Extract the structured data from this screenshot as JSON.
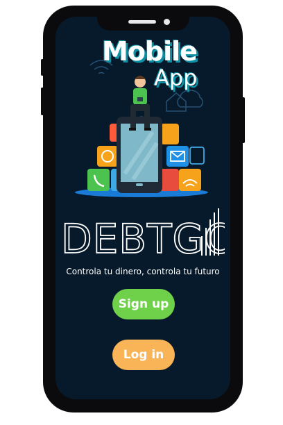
{
  "hero": {
    "title_line1": "Mobile",
    "title_line2": "App"
  },
  "brand": {
    "logo_text": "DEBTGO"
  },
  "tagline": "Controla tu dinero, controla tu futuro",
  "actions": {
    "signup_label": "Sign up",
    "login_label": "Log in"
  },
  "colors": {
    "screen_bg": "#071a2b",
    "signup": "#6fd04a",
    "login": "#f8b457",
    "accent": "#0e8fa3"
  }
}
